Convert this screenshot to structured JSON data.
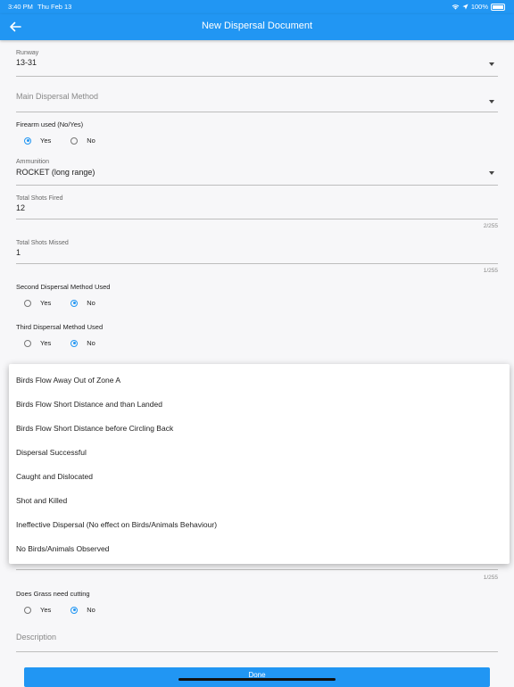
{
  "status": {
    "time": "3:40 PM",
    "date": "Thu Feb 13",
    "battery": "100%"
  },
  "header": {
    "title": "New Dispersal Document"
  },
  "runway": {
    "label": "Runway",
    "value": "13-31"
  },
  "main_method": {
    "placeholder": "Main Dispersal Method"
  },
  "firearm": {
    "label": "Firearm used (No/Yes)",
    "yes": "Yes",
    "no": "No",
    "selected": "Yes"
  },
  "ammunition": {
    "label": "Ammunition",
    "value": "ROCKET (long range)"
  },
  "shots_fired": {
    "label": "Total Shots Fired",
    "value": "12",
    "counter": "2/255"
  },
  "shots_missed": {
    "label": "Total Shots Missed",
    "value": "1",
    "counter": "1/255"
  },
  "second_method": {
    "label": "Second Dispersal Method Used",
    "yes": "Yes",
    "no": "No",
    "selected": "No"
  },
  "third_method": {
    "label": "Third Dispersal Method Used",
    "yes": "Yes",
    "no": "No",
    "selected": "No"
  },
  "dropdown": {
    "options": [
      "Birds Flow Away Out of Zone A",
      "Birds Flow Short Distance and than Landed",
      "Birds Flow Short Distance before Circling Back",
      "Dispersal Successful",
      "Caught and Dislocated",
      "Shot and Killed",
      "Ineffective Dispersal (No effect on Birds/Animals Behaviour)",
      "No Birds/Animals Observed"
    ]
  },
  "result_counter": "1/255",
  "grass": {
    "label": "Does Grass need cutting",
    "yes": "Yes",
    "no": "No",
    "selected": "No"
  },
  "description": {
    "placeholder": "Description"
  },
  "done_label": "Done",
  "colors": {
    "primary": "#2196f3"
  }
}
